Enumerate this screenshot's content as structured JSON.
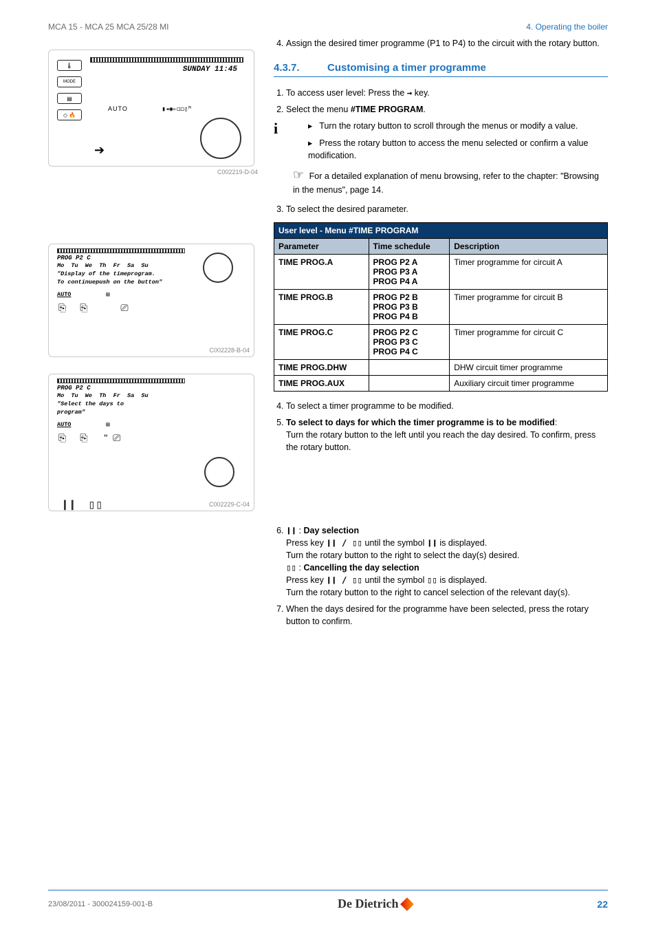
{
  "header": {
    "left": "MCA 15 - MCA 25 MCA 25/28 MI",
    "right": "4.  Operating the boiler"
  },
  "step4_top": "Assign the desired timer programme (P1 to P4) to the circuit with the rotary button.",
  "section": {
    "num": "4.3.7.",
    "title": "Customising a timer programme"
  },
  "steps_a": {
    "s1_pre": "To access user level: Press the ",
    "s1_post": " key.",
    "s2_pre": "Select the menu ",
    "s2_bold": "#TIME PROGRAM",
    "s2_post": "."
  },
  "info": {
    "b1": "Turn the rotary button to scroll through the menus or modify a value.",
    "b2": "Press the rotary button to access the menu selected or confirm a value modification.",
    "hand_pre": " For a detailed explanation of menu browsing, refer to the chapter:  \"Browsing in the menus\", page 14."
  },
  "step3": "To select the desired parameter.",
  "table": {
    "title": "User level - Menu #TIME PROGRAM",
    "cols": [
      "Parameter",
      "Time schedule",
      "Description"
    ],
    "rows": [
      {
        "p": "TIME PROG.A",
        "t": "PROG P2 A\nPROG P3 A\nPROG P4 A",
        "d": "Timer programme  for circuit A"
      },
      {
        "p": "TIME PROG.B",
        "t": "PROG P2 B\nPROG P3 B\nPROG P4 B",
        "d": "Timer programme  for circuit B"
      },
      {
        "p": "TIME PROG.C",
        "t": "PROG P2 C\nPROG P3 C\nPROG P4 C",
        "d": "Timer programme  for circuit C"
      },
      {
        "p": "TIME PROG.DHW",
        "t": "",
        "d": "DHW circuit timer programme"
      },
      {
        "p": "TIME PROG.AUX",
        "t": "",
        "d": "Auxiliary circuit timer programme"
      }
    ]
  },
  "steps_b": {
    "s4": "To select a timer programme to be modified.",
    "s5_bold": "To select to days for which the timer programme is to be modified",
    "s5_rest": "Turn the rotary button to the left until you reach the day desired. To confirm, press the rotary button."
  },
  "steps_c": {
    "s6_label": "Day selection",
    "s6_l1_pre": "Press key ",
    "s6_l1_mid": " until the symbol ",
    "s6_l1_post": " is displayed.",
    "s6_l2": "Turn the rotary button to the right to select the day(s) desired.",
    "s6_cancel": "Cancelling the day selection",
    "s6_l3_pre": "Press key ",
    "s6_l3_mid": " until the symbol ",
    "s6_l3_post": " is displayed.",
    "s6_l4": "Turn the rotary button to the right to cancel selection of the relevant day(s).",
    "s7": "When the days desired for the programme have been selected, press the rotary button to confirm."
  },
  "fig1": {
    "lcd_title": "SUNDAY 11:45",
    "auto": "AUTO",
    "bar": "▮◂◉▹◻◻▯ᴹ",
    "mode": "MODE",
    "cap": "C002219-D-04"
  },
  "fig2": {
    "title": "PROG P2 C",
    "days": "Mo  Tu  We  Th  Fr  Sa  Su",
    "l1": "\"Display of the timeprogram.",
    "l2": "To continuepush on the button\"",
    "auto": "AUTO",
    "cap": "C002228-B-04"
  },
  "fig3": {
    "title": "PROG P2 C",
    "days": "Mo  Tu  We  Th  Fr  Sa  Su",
    "l1": "\"Select the days to",
    "l2": "program\"",
    "auto": "AUTO",
    "cap": "C002229-C-04",
    "sym1": "❙❙",
    "sym2": "▯▯"
  },
  "glyphs": {
    "arrow_r": "→",
    "bar_solid": "❙❙",
    "bar_hollow": "▯▯",
    "bar_pair": "❙❙ / ▯▯"
  },
  "footer": {
    "left": "23/08/2011  - 300024159-001-B",
    "logo": "De Dietrich",
    "page": "22"
  }
}
